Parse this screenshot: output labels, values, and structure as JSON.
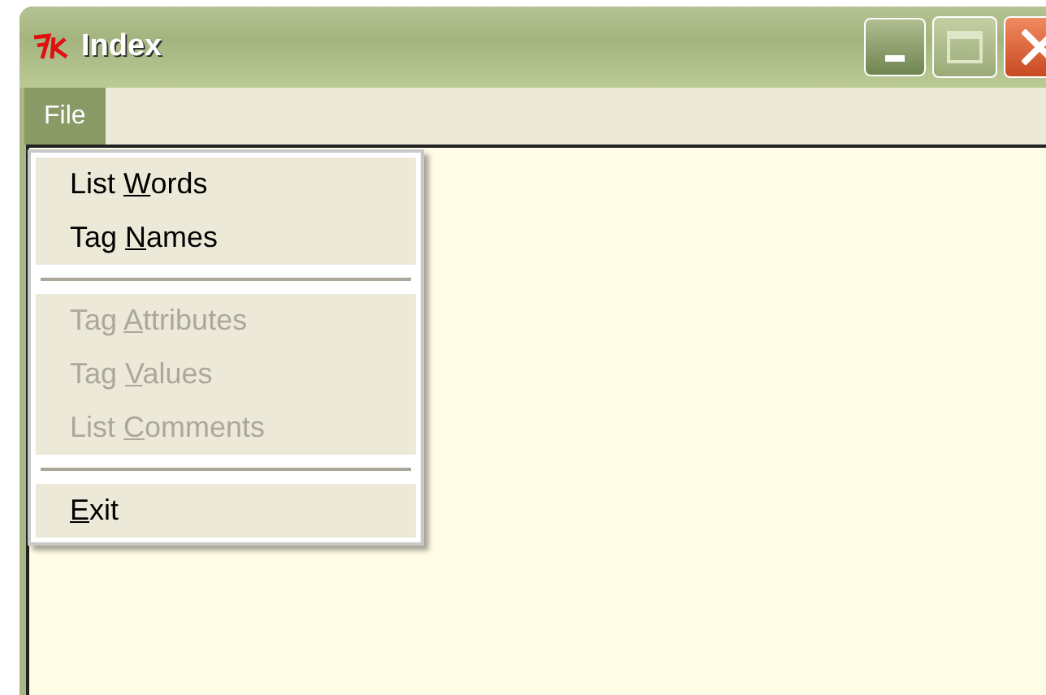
{
  "window": {
    "title": "Index"
  },
  "menubar": [
    {
      "label": "File",
      "selected": true
    }
  ],
  "menu": [
    {
      "kind": "item",
      "before": "List ",
      "key": "W",
      "after": "ords",
      "disabled": false
    },
    {
      "kind": "item",
      "before": "Tag ",
      "key": "N",
      "after": "ames",
      "disabled": false
    },
    {
      "kind": "separator"
    },
    {
      "kind": "item",
      "before": "Tag ",
      "key": "A",
      "after": "ttributes",
      "disabled": true
    },
    {
      "kind": "item",
      "before": "Tag ",
      "key": "V",
      "after": "alues",
      "disabled": true
    },
    {
      "kind": "item",
      "before": "List ",
      "key": "C",
      "after": "omments",
      "disabled": true
    },
    {
      "kind": "separator"
    },
    {
      "kind": "item",
      "key": "E",
      "after": "xit",
      "disabled": false
    }
  ]
}
